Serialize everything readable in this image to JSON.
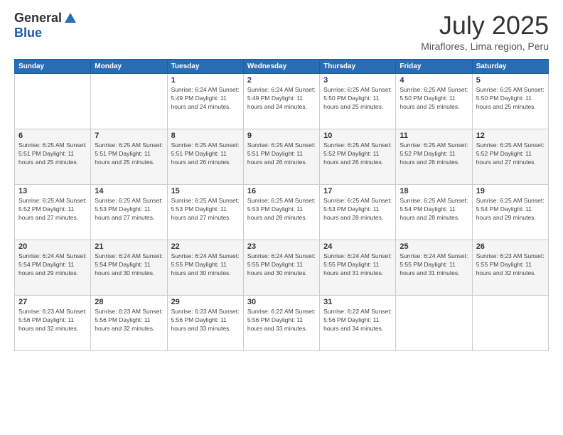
{
  "header": {
    "logo_general": "General",
    "logo_blue": "Blue",
    "month_title": "July 2025",
    "location": "Miraflores, Lima region, Peru"
  },
  "weekdays": [
    "Sunday",
    "Monday",
    "Tuesday",
    "Wednesday",
    "Thursday",
    "Friday",
    "Saturday"
  ],
  "weeks": [
    [
      {
        "day": "",
        "info": ""
      },
      {
        "day": "",
        "info": ""
      },
      {
        "day": "1",
        "info": "Sunrise: 6:24 AM\nSunset: 5:49 PM\nDaylight: 11 hours and 24 minutes."
      },
      {
        "day": "2",
        "info": "Sunrise: 6:24 AM\nSunset: 5:49 PM\nDaylight: 11 hours and 24 minutes."
      },
      {
        "day": "3",
        "info": "Sunrise: 6:25 AM\nSunset: 5:50 PM\nDaylight: 11 hours and 25 minutes."
      },
      {
        "day": "4",
        "info": "Sunrise: 6:25 AM\nSunset: 5:50 PM\nDaylight: 11 hours and 25 minutes."
      },
      {
        "day": "5",
        "info": "Sunrise: 6:25 AM\nSunset: 5:50 PM\nDaylight: 11 hours and 25 minutes."
      }
    ],
    [
      {
        "day": "6",
        "info": "Sunrise: 6:25 AM\nSunset: 5:51 PM\nDaylight: 11 hours and 25 minutes."
      },
      {
        "day": "7",
        "info": "Sunrise: 6:25 AM\nSunset: 5:51 PM\nDaylight: 11 hours and 25 minutes."
      },
      {
        "day": "8",
        "info": "Sunrise: 6:25 AM\nSunset: 5:51 PM\nDaylight: 11 hours and 26 minutes."
      },
      {
        "day": "9",
        "info": "Sunrise: 6:25 AM\nSunset: 5:51 PM\nDaylight: 11 hours and 26 minutes."
      },
      {
        "day": "10",
        "info": "Sunrise: 6:25 AM\nSunset: 5:52 PM\nDaylight: 11 hours and 26 minutes."
      },
      {
        "day": "11",
        "info": "Sunrise: 6:25 AM\nSunset: 5:52 PM\nDaylight: 11 hours and 26 minutes."
      },
      {
        "day": "12",
        "info": "Sunrise: 6:25 AM\nSunset: 5:52 PM\nDaylight: 11 hours and 27 minutes."
      }
    ],
    [
      {
        "day": "13",
        "info": "Sunrise: 6:25 AM\nSunset: 5:52 PM\nDaylight: 11 hours and 27 minutes."
      },
      {
        "day": "14",
        "info": "Sunrise: 6:25 AM\nSunset: 5:53 PM\nDaylight: 11 hours and 27 minutes."
      },
      {
        "day": "15",
        "info": "Sunrise: 6:25 AM\nSunset: 5:53 PM\nDaylight: 11 hours and 27 minutes."
      },
      {
        "day": "16",
        "info": "Sunrise: 6:25 AM\nSunset: 5:53 PM\nDaylight: 11 hours and 28 minutes."
      },
      {
        "day": "17",
        "info": "Sunrise: 6:25 AM\nSunset: 5:53 PM\nDaylight: 11 hours and 28 minutes."
      },
      {
        "day": "18",
        "info": "Sunrise: 6:25 AM\nSunset: 5:54 PM\nDaylight: 11 hours and 28 minutes."
      },
      {
        "day": "19",
        "info": "Sunrise: 6:25 AM\nSunset: 5:54 PM\nDaylight: 11 hours and 29 minutes."
      }
    ],
    [
      {
        "day": "20",
        "info": "Sunrise: 6:24 AM\nSunset: 5:54 PM\nDaylight: 11 hours and 29 minutes."
      },
      {
        "day": "21",
        "info": "Sunrise: 6:24 AM\nSunset: 5:54 PM\nDaylight: 11 hours and 30 minutes."
      },
      {
        "day": "22",
        "info": "Sunrise: 6:24 AM\nSunset: 5:55 PM\nDaylight: 11 hours and 30 minutes."
      },
      {
        "day": "23",
        "info": "Sunrise: 6:24 AM\nSunset: 5:55 PM\nDaylight: 11 hours and 30 minutes."
      },
      {
        "day": "24",
        "info": "Sunrise: 6:24 AM\nSunset: 5:55 PM\nDaylight: 11 hours and 31 minutes."
      },
      {
        "day": "25",
        "info": "Sunrise: 6:24 AM\nSunset: 5:55 PM\nDaylight: 11 hours and 31 minutes."
      },
      {
        "day": "26",
        "info": "Sunrise: 6:23 AM\nSunset: 5:55 PM\nDaylight: 11 hours and 32 minutes."
      }
    ],
    [
      {
        "day": "27",
        "info": "Sunrise: 6:23 AM\nSunset: 5:56 PM\nDaylight: 11 hours and 32 minutes."
      },
      {
        "day": "28",
        "info": "Sunrise: 6:23 AM\nSunset: 5:56 PM\nDaylight: 11 hours and 32 minutes."
      },
      {
        "day": "29",
        "info": "Sunrise: 6:23 AM\nSunset: 5:56 PM\nDaylight: 11 hours and 33 minutes."
      },
      {
        "day": "30",
        "info": "Sunrise: 6:22 AM\nSunset: 5:56 PM\nDaylight: 11 hours and 33 minutes."
      },
      {
        "day": "31",
        "info": "Sunrise: 6:22 AM\nSunset: 5:56 PM\nDaylight: 11 hours and 34 minutes."
      },
      {
        "day": "",
        "info": ""
      },
      {
        "day": "",
        "info": ""
      }
    ]
  ]
}
